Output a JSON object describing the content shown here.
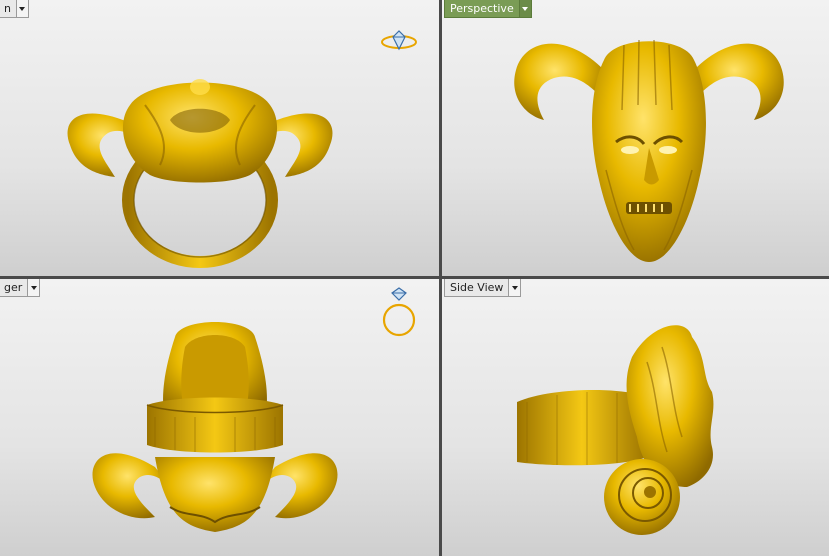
{
  "viewports": [
    {
      "id": "top-left",
      "label": "n",
      "active": false
    },
    {
      "id": "top-right",
      "label": "Perspective",
      "active": true
    },
    {
      "id": "bottom-left",
      "label": "ger",
      "active": false
    },
    {
      "id": "bottom-right",
      "label": "Side View",
      "active": false
    }
  ],
  "icons": {
    "orientation_top": "ring-side-gem-icon",
    "orientation_bottom": "ring-front-gem-icon",
    "dropdown": "chevron-down-icon"
  },
  "colors": {
    "model_gold": "#e8b900",
    "model_shadow": "#8f6a00",
    "active_tab": "#7a9c55",
    "viewport_bg": "#ececec",
    "separator": "#4a4a4a"
  }
}
